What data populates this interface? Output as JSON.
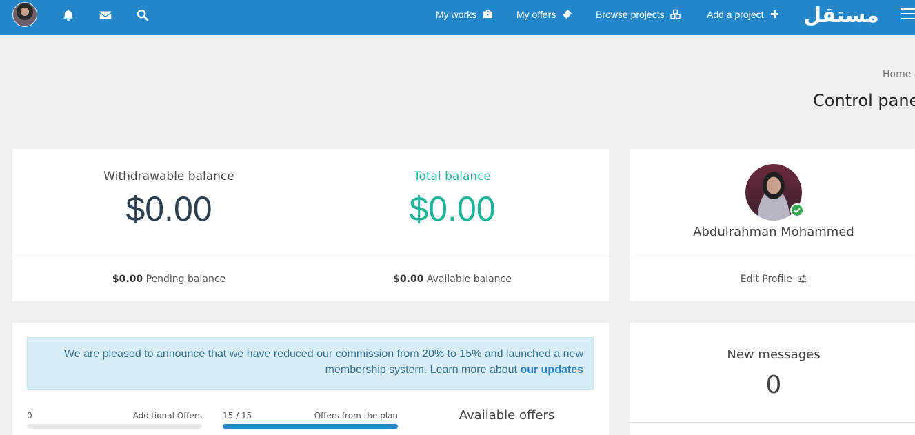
{
  "nav": {
    "my_works": "My works",
    "my_offers": "My offers",
    "browse_projects": "Browse projects",
    "add_project": "Add a project",
    "logo_text": "مستقل",
    "icons": [
      "bell-icon",
      "envelope-icon",
      "search-icon",
      "briefcase-icon",
      "ticket-icon",
      "cubes-icon",
      "plus-icon",
      "menu-icon"
    ]
  },
  "breadcrumb": "Home",
  "page_title": "Control panel",
  "balance": {
    "withdrawable_label": "Withdrawable balance",
    "withdrawable_amount": "$0.00",
    "total_label": "Total balance",
    "total_amount": "$0.00",
    "pending_amount": "$0.00",
    "pending_label": "Pending balance",
    "available_amount": "$0.00",
    "available_label": "Available balance"
  },
  "profile": {
    "name": "Abdulrahman Mohammed",
    "edit_label": "Edit Profile"
  },
  "announcement": {
    "text": "We are pleased to announce that we have reduced our commission from 20% to 15% and launched a new membership system. Learn more about",
    "link_text": "our updates"
  },
  "offers": {
    "title": "Available offers",
    "additional_label": "Additional Offers",
    "additional_value": "0",
    "additional_fraction": 0,
    "plan_label": "Offers from the plan",
    "plan_value": "15 / 15",
    "plan_fraction": 1
  },
  "messages": {
    "label": "New messages",
    "count": "0"
  },
  "colors": {
    "brand": "#2386c8",
    "teal": "#1fb39a",
    "navy": "#2c3e50"
  }
}
